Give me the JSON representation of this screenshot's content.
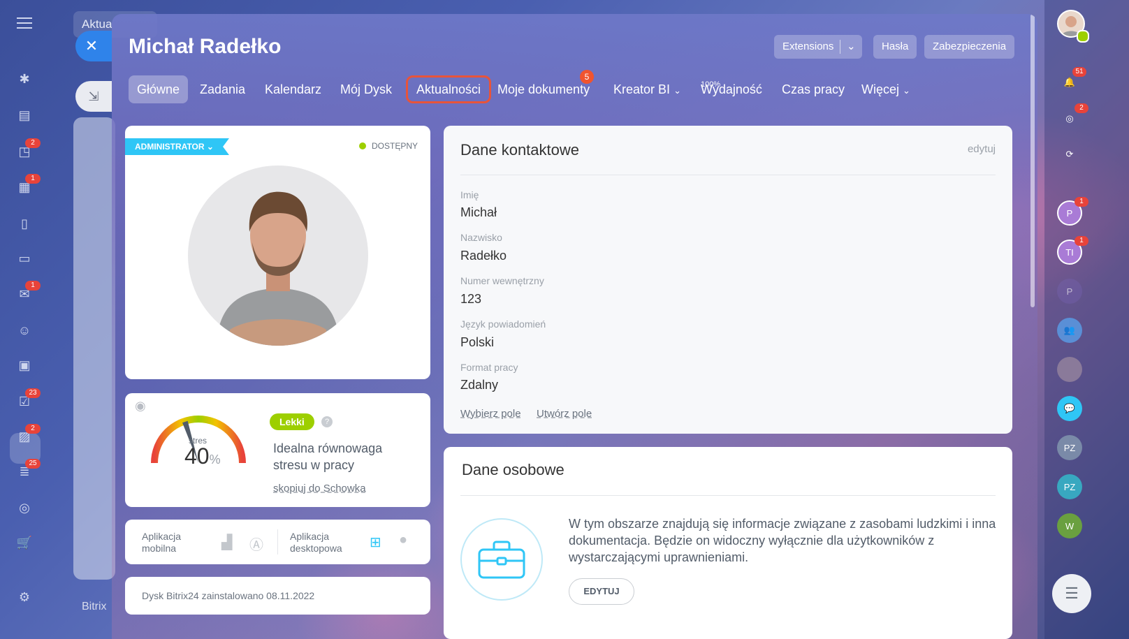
{
  "background": {
    "back_tab": "Aktua",
    "back_bottom": "Bitrix"
  },
  "left_sidebar": {
    "badges": [
      "2",
      "1",
      "1",
      "23",
      "2",
      "25"
    ]
  },
  "header": {
    "title": "Michał Radełko",
    "extensions": "Extensions",
    "hasla": "Hasła",
    "zabezpieczenia": "Zabezpieczenia"
  },
  "tabs": [
    {
      "label": "Główne"
    },
    {
      "label": "Zadania"
    },
    {
      "label": "Kalendarz"
    },
    {
      "label": "Mój Dysk"
    },
    {
      "label": "Aktualności"
    },
    {
      "label": "Moje dokumenty",
      "badge": "5"
    },
    {
      "label": "Kreator BI"
    },
    {
      "label": "Wydajność",
      "pct": "100%"
    },
    {
      "label": "Czas pracy"
    },
    {
      "label": "Więcej"
    }
  ],
  "profile_card": {
    "role": "ADMINISTRATOR",
    "status": "DOSTĘPNY"
  },
  "stress": {
    "badge": "Lekki",
    "label": "stres",
    "value": "40",
    "unit": "%",
    "level": 0.4,
    "desc1": "Idealna równowaga",
    "desc2": "stresu w pracy",
    "copy": "skopiuj do Schowka"
  },
  "apps": {
    "mobile1": "Aplikacja",
    "mobile2": "mobilna",
    "desktop1": "Aplikacja",
    "desktop2": "desktopowa"
  },
  "disk": "Dysk Bitrix24 zainstalowano 08.11.2022",
  "contact": {
    "title": "Dane kontaktowe",
    "edit": "edytuj",
    "fields": [
      {
        "label": "Imię",
        "value": "Michał"
      },
      {
        "label": "Nazwisko",
        "value": "Radełko"
      },
      {
        "label": "Numer wewnętrzny",
        "value": "123"
      },
      {
        "label": "Język powiadomień",
        "value": "Polski"
      },
      {
        "label": "Format pracy",
        "value": "Zdalny"
      }
    ],
    "choose_field": "Wybierz pole",
    "create_field": "Utwórz pole"
  },
  "personal": {
    "title": "Dane osobowe",
    "text": "W tym obszarze znajdują się informacje związane z zasobami ludzkimi i inna dokumentacja. Będzie on widoczny wyłącznie dla użytkowników z wystarczającymi uprawnieniami.",
    "button": "EDYTUJ"
  },
  "right_sidebar": {
    "notif_badge": "51",
    "target_badge": "2",
    "p1": "P",
    "p1_badge": "1",
    "ti": "TI",
    "ti_badge": "1",
    "p2": "P",
    "pz1": "PZ",
    "pz2": "PZ",
    "w": "W"
  },
  "colors": {
    "accent": "#2fc6f6",
    "close": "#2f83ea",
    "badge": "#f0542f",
    "available": "#9dcf00"
  }
}
